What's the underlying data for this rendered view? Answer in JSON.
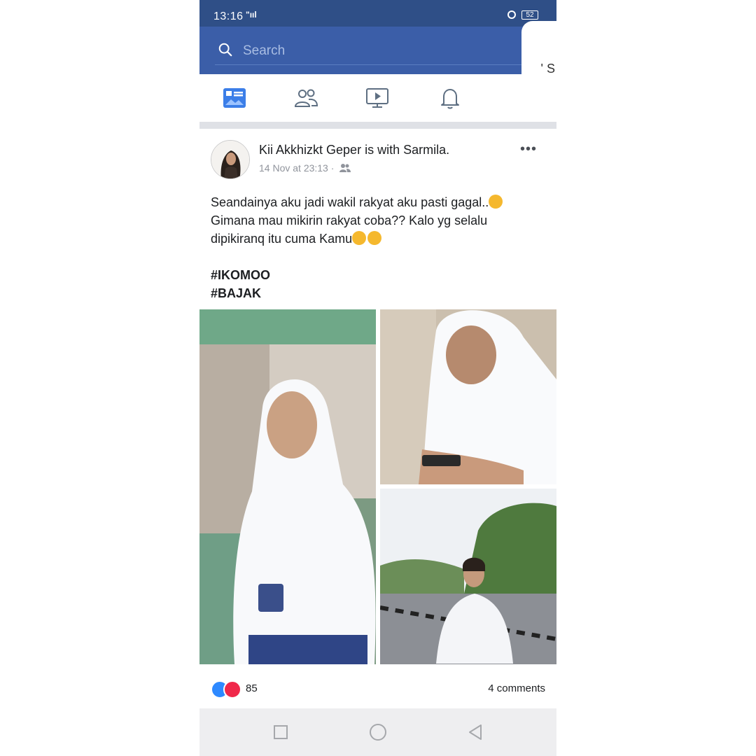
{
  "status_bar": {
    "time": "13:16",
    "signal": "\"ııl",
    "battery": "52"
  },
  "search": {
    "placeholder": "Search",
    "scribble_1": "' S",
    "scribble_2": "ș"
  },
  "tabs": [
    {
      "name": "news-feed",
      "icon": "news-feed-icon",
      "active": true
    },
    {
      "name": "friends",
      "icon": "friends-icon"
    },
    {
      "name": "watch",
      "icon": "video-icon"
    },
    {
      "name": "notifications",
      "icon": "bell-icon"
    }
  ],
  "post": {
    "author": "Kii Akkhizkt Geper",
    "with_text": "is with",
    "tagged": "Sarmila.",
    "timestamp": "14 Nov at 23:13",
    "separator": "·",
    "audience_icon": "friends-audience-icon",
    "more": "•••",
    "text_lines": [
      "Seandainya aku jadi wakil rakyat aku pasti gagal..",
      "Gimana mau mikirin rakyat coba?? Kalo yg selalu",
      "dipikiranq itu cuma Kamu"
    ],
    "hashtags": [
      "#IKOMOO",
      "#BAJAK"
    ],
    "reactions": {
      "count": "85",
      "types": [
        "like",
        "love"
      ]
    },
    "comments": "4 comments"
  },
  "nav": {
    "buttons": [
      "recent-apps",
      "home",
      "back"
    ]
  },
  "colors": {
    "header_blue": "#3b5ea8",
    "status_blue": "#2f4f87",
    "like_blue": "#2e89ff",
    "love_red": "#f0284a"
  }
}
